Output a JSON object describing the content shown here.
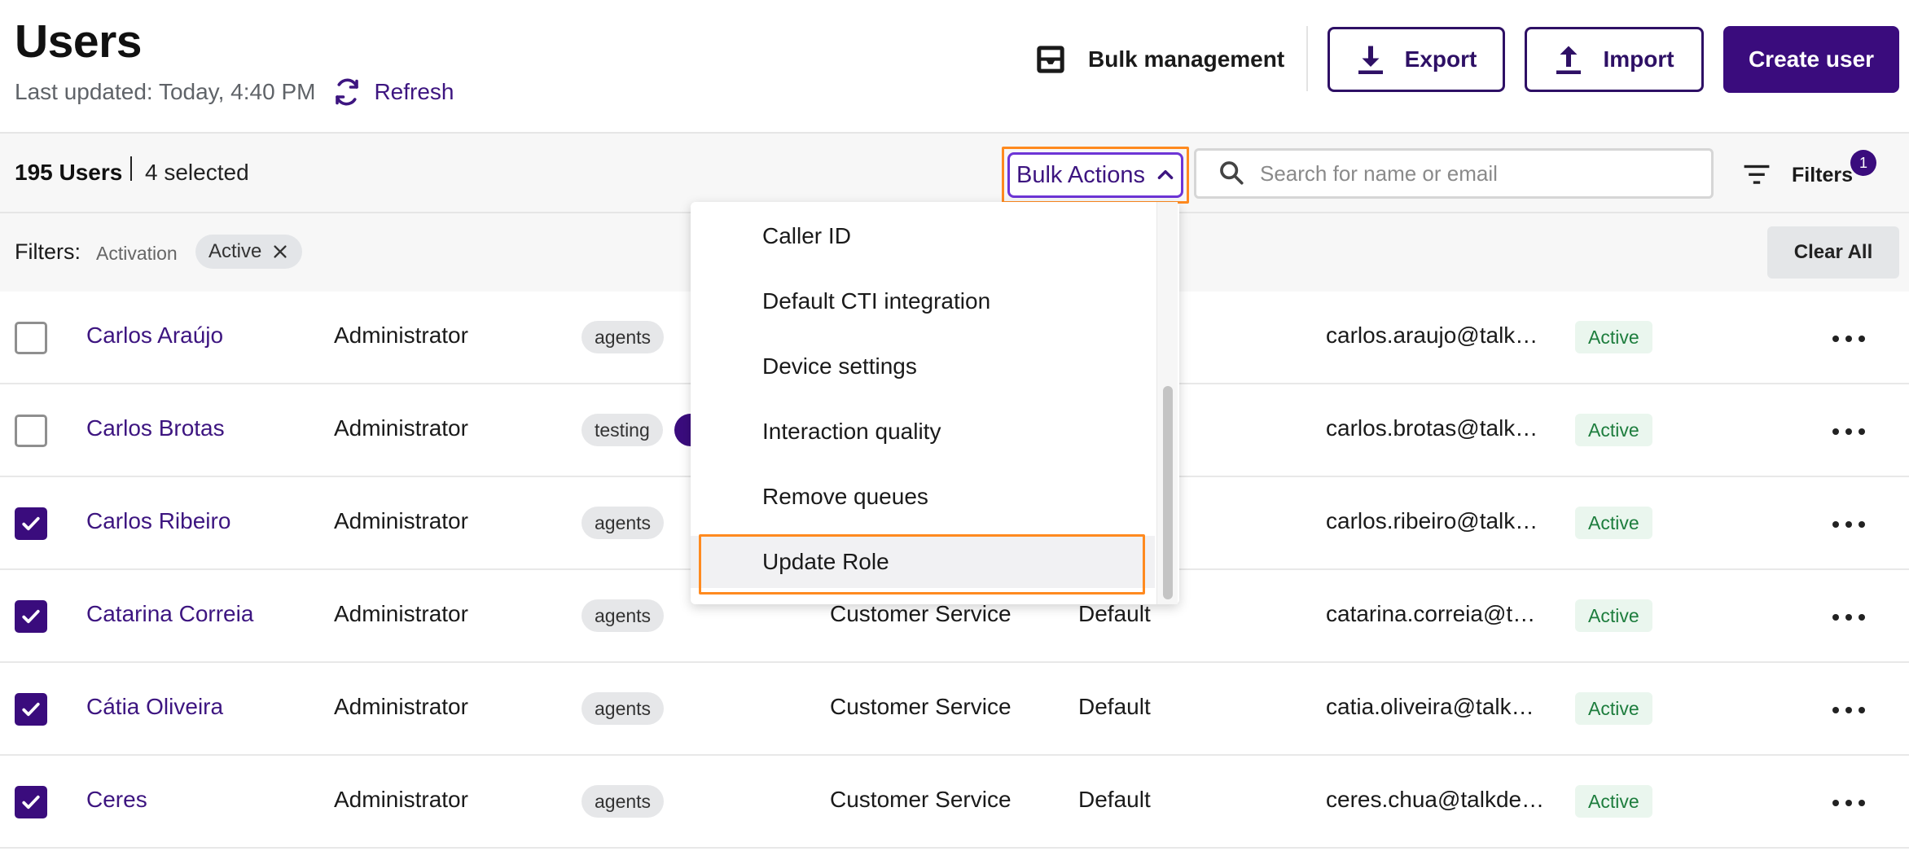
{
  "header": {
    "title": "Users",
    "last_updated": "Last updated: Today, 4:40 PM",
    "refresh_label": "Refresh",
    "bulk_management_label": "Bulk management",
    "export_label": "Export",
    "import_label": "Import",
    "create_user_label": "Create user"
  },
  "toolbar": {
    "user_count": "195 Users",
    "selected_count": "4 selected",
    "bulk_actions_label": "Bulk Actions",
    "search_placeholder": "Search for name or email",
    "filters_label": "Filters",
    "filters_badge": "1"
  },
  "filter_row": {
    "label": "Filters:",
    "field": "Activation",
    "chip_value": "Active",
    "clear_all_label": "Clear All"
  },
  "bulk_actions_menu": {
    "items": [
      {
        "label": "Caller ID"
      },
      {
        "label": "Default CTI integration"
      },
      {
        "label": "Device settings"
      },
      {
        "label": "Interaction quality"
      },
      {
        "label": "Remove queues"
      },
      {
        "label": "Update Role"
      }
    ],
    "highlighted": "Update Role"
  },
  "users": [
    {
      "name": "Carlos Araújo",
      "role": "Administrator",
      "tag": "agents",
      "team": "",
      "profile": "",
      "email": "carlos.araujo@talk…",
      "status": "Active",
      "selected": false
    },
    {
      "name": "Carlos Brotas",
      "role": "Administrator",
      "tag": "testing",
      "team": "",
      "profile": "",
      "email": "carlos.brotas@talk…",
      "status": "Active",
      "selected": false
    },
    {
      "name": "Carlos Ribeiro",
      "role": "Administrator",
      "tag": "agents",
      "team": "",
      "profile": "",
      "email": "carlos.ribeiro@talk…",
      "status": "Active",
      "selected": true
    },
    {
      "name": "Catarina Correia",
      "role": "Administrator",
      "tag": "agents",
      "team": "Customer Service",
      "profile": "Default",
      "email": "catarina.correia@ta…",
      "status": "Active",
      "selected": true
    },
    {
      "name": "Cátia Oliveira",
      "role": "Administrator",
      "tag": "agents",
      "team": "Customer Service",
      "profile": "Default",
      "email": "catia.oliveira@talkd…",
      "status": "Active",
      "selected": true
    },
    {
      "name": "Ceres",
      "role": "Administrator",
      "tag": "agents",
      "team": "Customer Service",
      "profile": "Default",
      "email": "ceres.chua@talkde…",
      "status": "Active",
      "selected": true
    }
  ],
  "colors": {
    "brand": "#3a0c7d",
    "link": "#3d1580",
    "annotation": "#ff8a1f",
    "status_green": "#1d7d3d"
  }
}
